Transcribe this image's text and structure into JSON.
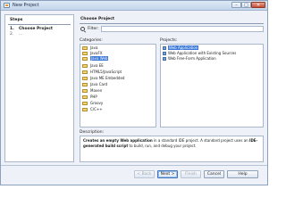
{
  "window": {
    "title": "New Project",
    "min_label": "–",
    "max_label": "□",
    "close_label": "✕"
  },
  "steps": {
    "heading": "Steps",
    "items": [
      {
        "num": "1.",
        "label": "Choose Project"
      },
      {
        "num": "2.",
        "label": "..."
      }
    ]
  },
  "main": {
    "heading": "Choose Project",
    "filter_label": "Filter:",
    "filter_value": "",
    "categories_label": "Categories:",
    "projects_label": "Projects:",
    "categories": [
      "Java",
      "JavaFX",
      "Java Web",
      "Java EE",
      "HTML5/JavaScript",
      "Java ME Embedded",
      "Java Card",
      "Maven",
      "PHP",
      "Groovy",
      "C/C++"
    ],
    "selected_category": "Java Web",
    "projects": [
      "Web Application",
      "Web Application with Existing Sources",
      "Web Free-Form Application"
    ],
    "selected_project": "Web Application",
    "description_label": "Description:",
    "description_bold_1": "Creates an empty Web application",
    "description_mid": " in a standard IDE project. A standard project uses an ",
    "description_bold_2": "IDE-generated build script",
    "description_end": " to build, run, and debug your project."
  },
  "buttons": {
    "back": "< Back",
    "next": "Next >",
    "finish": "Finish",
    "cancel": "Cancel",
    "help": "Help"
  }
}
